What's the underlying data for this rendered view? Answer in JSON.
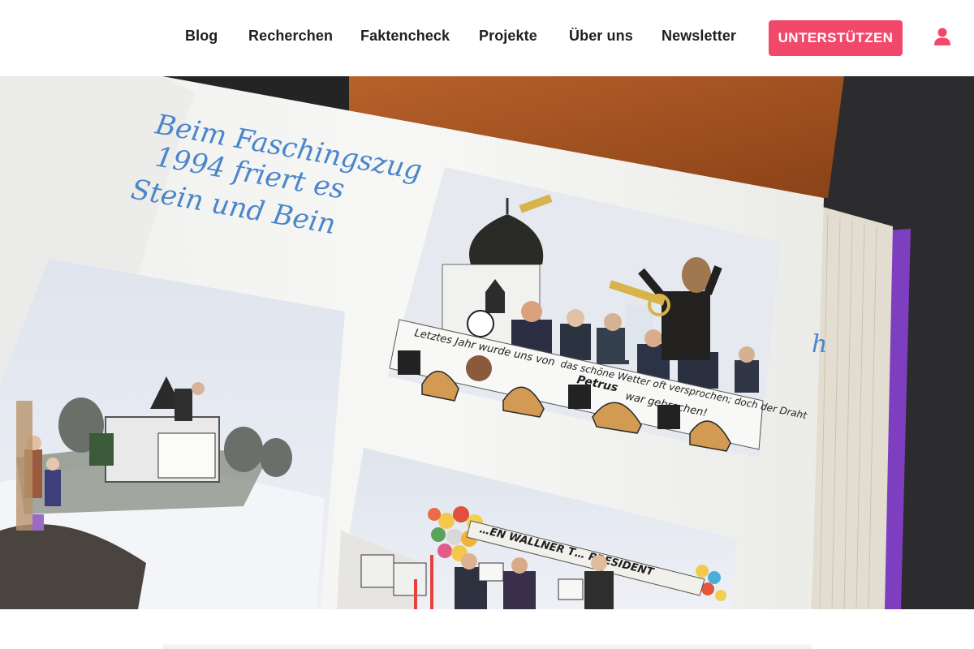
{
  "nav": {
    "items": [
      {
        "label": "Blog"
      },
      {
        "label": "Recherchen"
      },
      {
        "label": "Faktencheck"
      },
      {
        "label": "Projekte"
      },
      {
        "label": "Über uns"
      },
      {
        "label": "Newsletter"
      }
    ],
    "support_label": "UNTERSTÜTZEN",
    "user_icon": "user-icon"
  },
  "hero": {
    "caption_line1": "Beim Faschingszug",
    "caption_line2": "1994 friert es",
    "caption_line3": "Stein und Bein",
    "banner_line1": "Letztes Jahr wurde uns von",
    "banner_line2": "das schöne Wetter oft versprochen; doch der Draht",
    "banner_line3": "Petrus",
    "banner_line4": "war gebrochen!",
    "banner2": "…EN WALLNER T… PRESIDENT",
    "page_margin_mark": "h"
  },
  "colors": {
    "accent": "#f2496a",
    "nav_text": "#1f1f1f",
    "handwriting": "#4a86c9",
    "binder_purple": "#7d3fbf"
  }
}
